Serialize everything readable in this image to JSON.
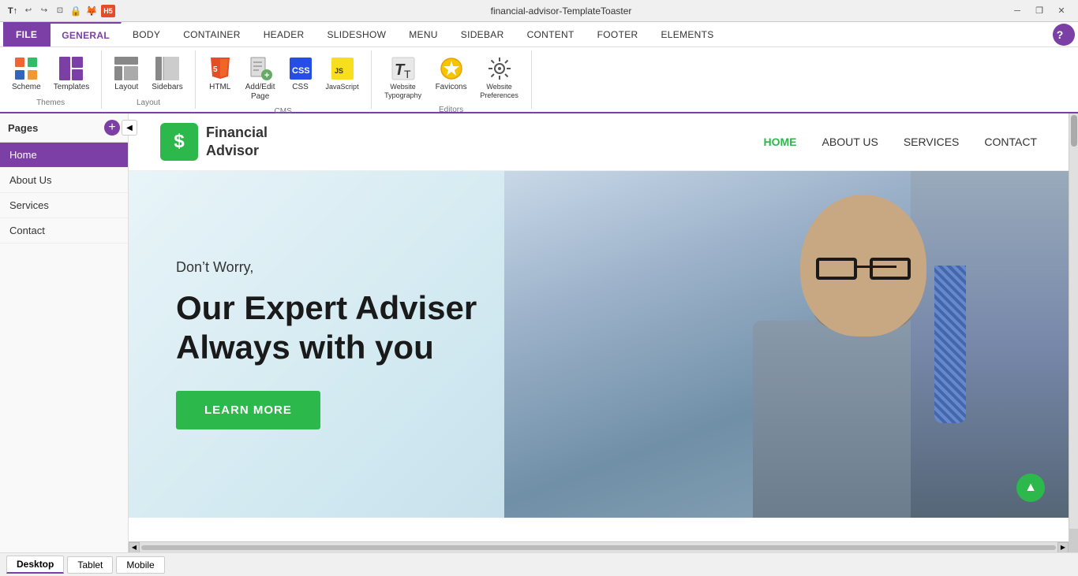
{
  "window": {
    "title": "financial-advisor-TemplateToaster",
    "controls": {
      "minimize": "─",
      "restore": "❐",
      "close": "✕"
    }
  },
  "titlebar": {
    "icons": [
      "T↑",
      "↩",
      "↪",
      "⊡",
      "🔒",
      "🦊",
      "H5"
    ]
  },
  "ribbon": {
    "tabs": [
      {
        "id": "file",
        "label": "FILE",
        "active": false,
        "is_file": true
      },
      {
        "id": "general",
        "label": "GENERAL",
        "active": true
      },
      {
        "id": "body",
        "label": "BODY",
        "active": false
      },
      {
        "id": "container",
        "label": "CONTAINER",
        "active": false
      },
      {
        "id": "header",
        "label": "HEADER",
        "active": false
      },
      {
        "id": "slideshow",
        "label": "SLIDESHOW",
        "active": false
      },
      {
        "id": "menu",
        "label": "MENU",
        "active": false
      },
      {
        "id": "sidebar",
        "label": "SIDEBAR",
        "active": false
      },
      {
        "id": "content",
        "label": "CONTENT",
        "active": false
      },
      {
        "id": "footer",
        "label": "FOOTER",
        "active": false
      },
      {
        "id": "elements",
        "label": "ELEMENTS",
        "active": false
      }
    ],
    "groups": [
      {
        "id": "themes",
        "label": "Themes",
        "buttons": [
          {
            "id": "scheme",
            "label": "Scheme",
            "icon": "scheme"
          },
          {
            "id": "templates",
            "label": "Templates",
            "icon": "templates"
          }
        ]
      },
      {
        "id": "layout",
        "label": "Layout",
        "buttons": [
          {
            "id": "layout",
            "label": "Layout",
            "icon": "layout"
          },
          {
            "id": "sidebars",
            "label": "Sidebars",
            "icon": "sidebars"
          }
        ]
      },
      {
        "id": "cms",
        "label": "CMS",
        "buttons": [
          {
            "id": "html",
            "label": "HTML",
            "icon": "html"
          },
          {
            "id": "addedit",
            "label": "Add/Edit\nPage",
            "icon": "addedit"
          },
          {
            "id": "css",
            "label": "CSS",
            "icon": "css"
          },
          {
            "id": "js",
            "label": "JavaScript",
            "icon": "js"
          }
        ]
      },
      {
        "id": "editors",
        "label": "Editors",
        "buttons": [
          {
            "id": "typography",
            "label": "Website\nTypography",
            "icon": "typography"
          },
          {
            "id": "favicons",
            "label": "Favicons",
            "icon": "favicons"
          },
          {
            "id": "preferences",
            "label": "Website\nPreferences",
            "icon": "preferences"
          }
        ]
      }
    ]
  },
  "sidebar": {
    "title": "Pages",
    "add_label": "+",
    "pages": [
      {
        "id": "home",
        "label": "Home",
        "active": true
      },
      {
        "id": "about",
        "label": "About Us",
        "active": false
      },
      {
        "id": "services",
        "label": "Services",
        "active": false
      },
      {
        "id": "contact",
        "label": "Contact",
        "active": false
      }
    ]
  },
  "site": {
    "logo_icon": "$",
    "logo_text_line1": "Financial",
    "logo_text_line2": "Advisor",
    "nav": [
      {
        "label": "HOME",
        "active": true
      },
      {
        "label": "ABOUT US",
        "active": false
      },
      {
        "label": "SERVICES",
        "active": false
      },
      {
        "label": "CONTACT",
        "active": false
      }
    ],
    "hero": {
      "subtitle": "Don’t Worry,",
      "title_line1": "Our Expert Adviser",
      "title_line2": "Always with you",
      "cta_label": "LEARN MORE"
    }
  },
  "statusbar": {
    "views": [
      {
        "id": "desktop",
        "label": "Desktop",
        "active": true
      },
      {
        "id": "tablet",
        "label": "Tablet",
        "active": false
      },
      {
        "id": "mobile",
        "label": "Mobile",
        "active": false
      }
    ]
  }
}
